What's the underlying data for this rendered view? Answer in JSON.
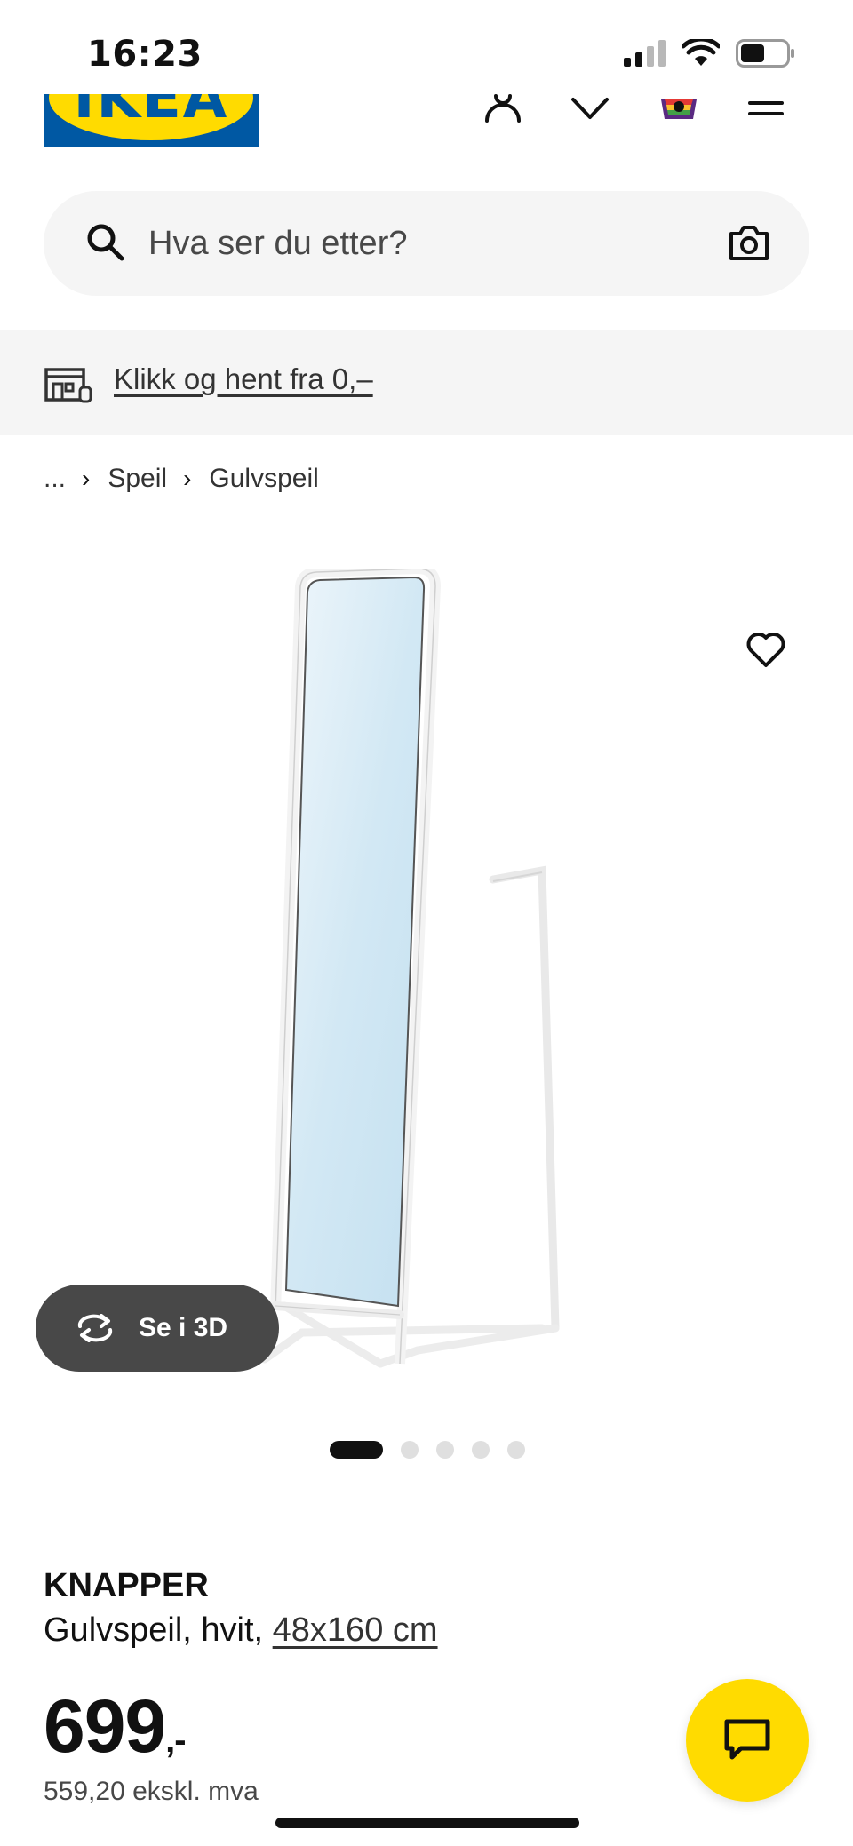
{
  "status_bar": {
    "time": "16:23"
  },
  "header": {
    "logo_text": "IKEA"
  },
  "search": {
    "placeholder": "Hva ser du etter?"
  },
  "banner": {
    "link_text": "Klikk og hent fra 0,–"
  },
  "breadcrumb": {
    "ellipsis": "...",
    "items": [
      "Speil",
      "Gulvspeil"
    ]
  },
  "media": {
    "view_3d_label": "Se i 3D",
    "carousel_count": 5,
    "carousel_active": 1
  },
  "product": {
    "name": "KNAPPER",
    "description": "Gulvspeil, hvit,",
    "dimensions": "48x160 cm",
    "price": "699",
    "price_suffix": ",-",
    "price_ex_vat": "559,20 ekskl. mva"
  },
  "colors": {
    "brand_blue": "#0058a3",
    "brand_yellow": "#ffdb00",
    "dark_button": "#484848"
  }
}
